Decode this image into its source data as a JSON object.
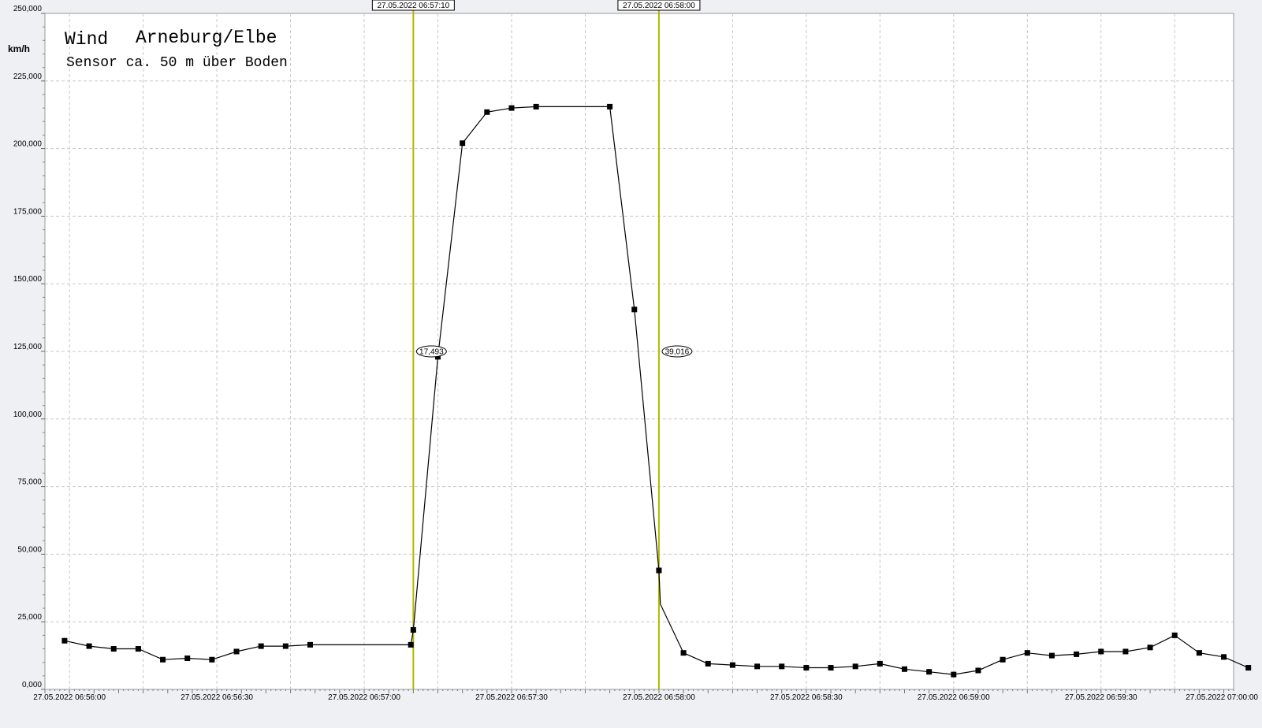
{
  "chart_data": {
    "type": "line",
    "title": "Wind",
    "location": "Arneburg/Elbe",
    "subtitle": "Sensor ca. 50 m über Boden",
    "ylabel": "km/h",
    "xlabel": "",
    "ylim": [
      0,
      250000
    ],
    "yticks": [
      {
        "value": 0,
        "label": "0,000"
      },
      {
        "value": 25000,
        "label": "25,000"
      },
      {
        "value": 50000,
        "label": "50,000"
      },
      {
        "value": 75000,
        "label": "75,000"
      },
      {
        "value": 100000,
        "label": "100,000"
      },
      {
        "value": 125000,
        "label": "125,000"
      },
      {
        "value": 150000,
        "label": "150,000"
      },
      {
        "value": 175000,
        "label": "175,000"
      },
      {
        "value": 200000,
        "label": "200,000"
      },
      {
        "value": 225000,
        "label": "225,000"
      },
      {
        "value": 250000,
        "label": "250,000"
      }
    ],
    "xlim_seconds": [
      0,
      242
    ],
    "xticks": [
      {
        "t": 5,
        "label": "27.05.2022  06:56:00"
      },
      {
        "t": 35,
        "label": "27.05.2022  06:56:30"
      },
      {
        "t": 65,
        "label": "27.05.2022  06:57:00"
      },
      {
        "t": 95,
        "label": "27.05.2022  06:57:30"
      },
      {
        "t": 125,
        "label": "27.05.2022  06:58:00"
      },
      {
        "t": 155,
        "label": "27.05.2022  06:58:30"
      },
      {
        "t": 185,
        "label": "27.05.2022  06:59:00"
      },
      {
        "t": 215,
        "label": "27.05.2022  06:59:30"
      },
      {
        "t": 245,
        "label": "27.05.2022  07:00:00"
      }
    ],
    "grid": true,
    "cursors": [
      {
        "t": 75,
        "label": "27.05.2022  06:57:10",
        "value_label": "17,493"
      },
      {
        "t": 125,
        "label": "27.05.2022  06:58:00",
        "value_label": "39,016"
      }
    ],
    "cursor_color": "#b5b800",
    "line_color": "#000000",
    "series": [
      {
        "points": [
          [
            4,
            18000
          ],
          [
            9,
            16000
          ],
          [
            14,
            15000
          ],
          [
            19,
            15000
          ],
          [
            24,
            11000
          ],
          [
            29,
            11500
          ],
          [
            34,
            11000
          ],
          [
            39,
            14000
          ],
          [
            44,
            16000
          ],
          [
            49,
            16000
          ],
          [
            54,
            16500
          ],
          [
            74.5,
            16500
          ],
          [
            75,
            22000
          ],
          [
            80,
            123000
          ],
          [
            85,
            202000
          ],
          [
            90,
            213500
          ],
          [
            95,
            215000
          ],
          [
            100,
            215500
          ],
          [
            115,
            215500
          ],
          [
            120,
            140500
          ],
          [
            125,
            44000
          ],
          [
            125.3,
            31500
          ],
          [
            130,
            13500
          ],
          [
            135,
            9500
          ],
          [
            140,
            9000
          ],
          [
            145,
            8500
          ],
          [
            150,
            8500
          ],
          [
            155,
            8000
          ],
          [
            160,
            8000
          ],
          [
            165,
            8500
          ],
          [
            170,
            9500
          ],
          [
            175,
            7500
          ],
          [
            180,
            6500
          ],
          [
            185,
            5500
          ],
          [
            190,
            7000
          ],
          [
            195,
            11000
          ],
          [
            200,
            13500
          ],
          [
            205,
            12500
          ],
          [
            210,
            13000
          ],
          [
            215,
            14000
          ],
          [
            220,
            14000
          ],
          [
            225,
            15500
          ],
          [
            230,
            20000
          ],
          [
            235,
            13500
          ],
          [
            240,
            12000
          ],
          [
            245,
            8000
          ]
        ]
      }
    ]
  }
}
